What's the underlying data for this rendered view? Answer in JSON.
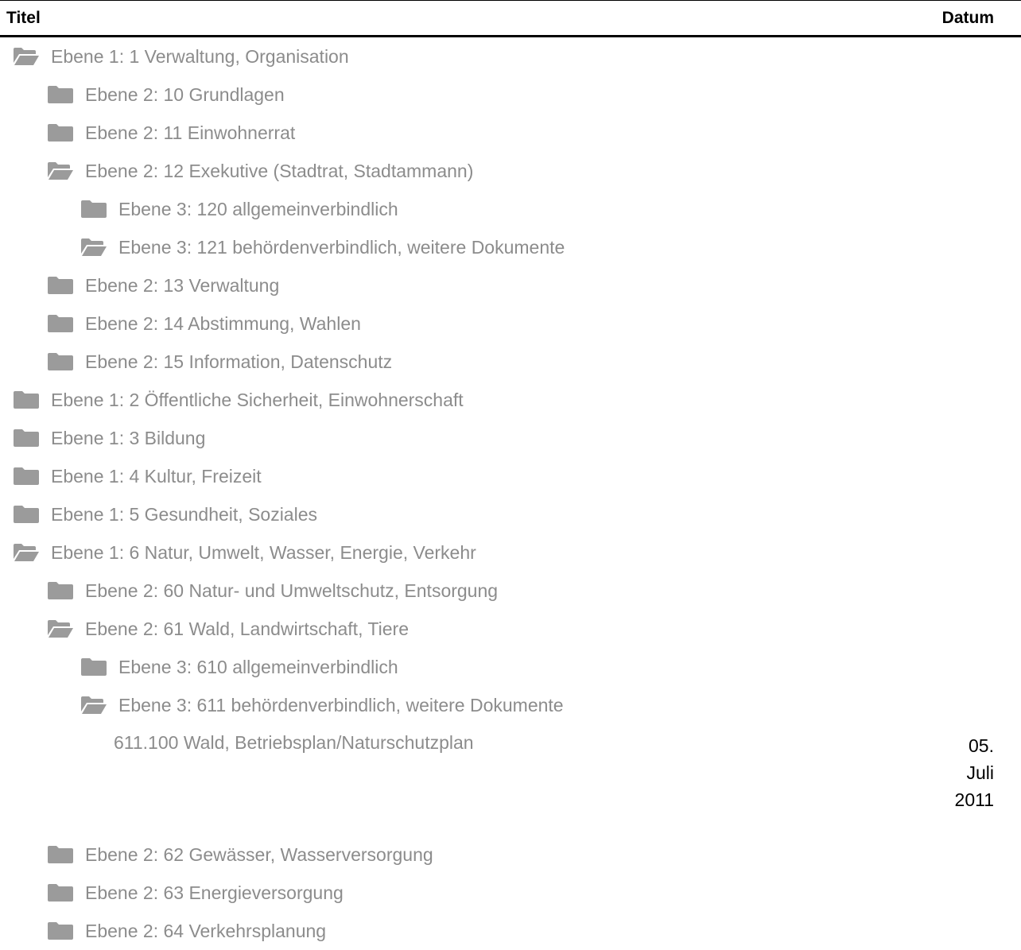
{
  "header": {
    "title": "Titel",
    "date": "Datum"
  },
  "rows": [
    {
      "level": 1,
      "icon": "folder-open-icon",
      "label": "Ebene 1: 1 Verwaltung, Organisation"
    },
    {
      "level": 2,
      "icon": "folder-icon",
      "label": "Ebene 2: 10 Grundlagen"
    },
    {
      "level": 2,
      "icon": "folder-icon",
      "label": "Ebene 2: 11 Einwohnerrat"
    },
    {
      "level": 2,
      "icon": "folder-open-icon",
      "label": "Ebene 2: 12 Exekutive (Stadtrat, Stadtammann)"
    },
    {
      "level": 3,
      "icon": "folder-icon",
      "label": "Ebene 3: 120 allgemeinverbindlich"
    },
    {
      "level": 3,
      "icon": "folder-open-icon",
      "label": "Ebene 3: 121 behördenverbindlich, weitere Dokumente"
    },
    {
      "level": 2,
      "icon": "folder-icon",
      "label": "Ebene 2: 13 Verwaltung"
    },
    {
      "level": 2,
      "icon": "folder-icon",
      "label": "Ebene 2: 14 Abstimmung, Wahlen"
    },
    {
      "level": 2,
      "icon": "folder-icon",
      "label": "Ebene 2: 15 Information, Datenschutz"
    },
    {
      "level": 1,
      "icon": "folder-icon",
      "label": "Ebene 1: 2 Öffentliche Sicherheit, Einwohnerschaft"
    },
    {
      "level": 1,
      "icon": "folder-icon",
      "label": "Ebene 1: 3 Bildung"
    },
    {
      "level": 1,
      "icon": "folder-icon",
      "label": "Ebene 1: 4 Kultur, Freizeit"
    },
    {
      "level": 1,
      "icon": "folder-icon",
      "label": "Ebene 1: 5 Gesundheit, Soziales"
    },
    {
      "level": 1,
      "icon": "folder-open-icon",
      "label": "Ebene 1: 6 Natur, Umwelt, Wasser, Energie, Verkehr"
    },
    {
      "level": 2,
      "icon": "folder-icon",
      "label": "Ebene 2: 60 Natur- und Umweltschutz, Entsorgung"
    },
    {
      "level": 2,
      "icon": "folder-open-icon",
      "label": "Ebene 2: 61 Wald, Landwirtschaft, Tiere"
    },
    {
      "level": 3,
      "icon": "folder-icon",
      "label": "Ebene 3: 610 allgemeinverbindlich"
    },
    {
      "level": 3,
      "icon": "folder-open-icon",
      "label": "Ebene 3: 611 behördenverbindlich, weitere Dokumente"
    },
    {
      "level": 4,
      "icon": "",
      "label": "611.100 Wald, Betriebsplan/Naturschutzplan",
      "date": [
        "05.",
        "Juli",
        "2011"
      ]
    },
    {
      "level": 2,
      "icon": "folder-icon",
      "label": "Ebene 2: 62 Gewässer, Wasserversorgung"
    },
    {
      "level": 2,
      "icon": "folder-icon",
      "label": "Ebene 2: 63 Energieversorgung"
    },
    {
      "level": 2,
      "icon": "folder-icon",
      "label": "Ebene 2: 64 Verkehrsplanung"
    }
  ]
}
